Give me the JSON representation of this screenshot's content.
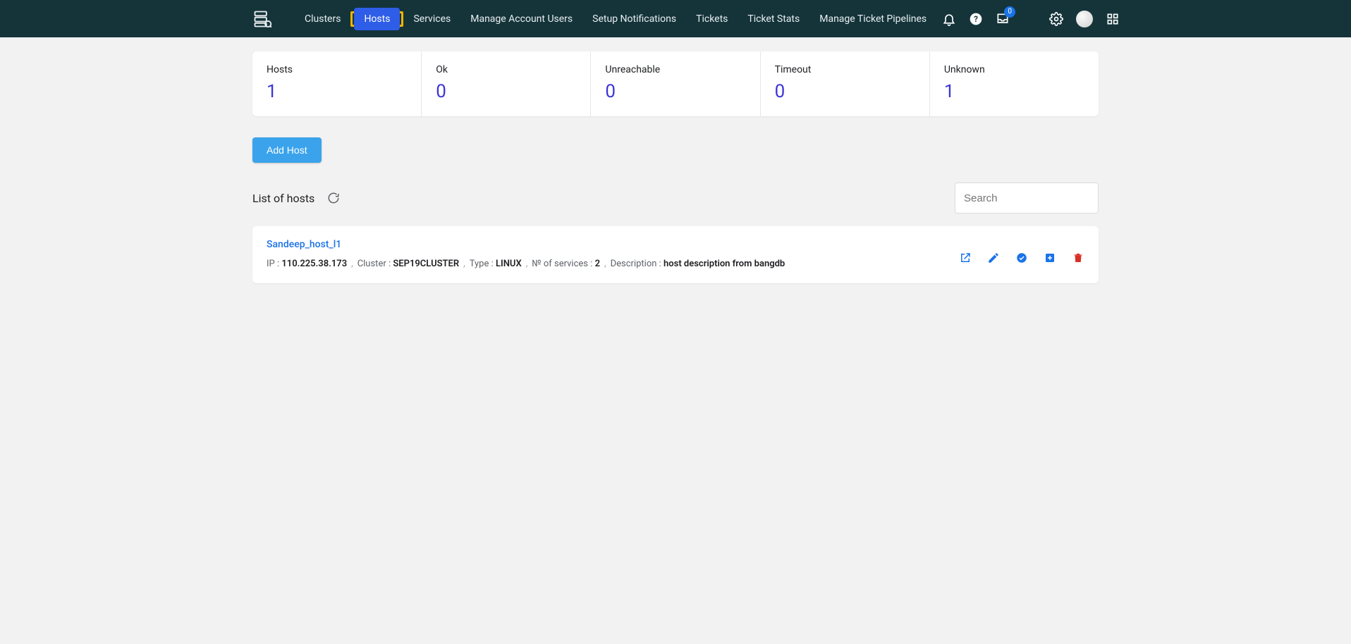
{
  "nav": {
    "items": [
      "Clusters",
      "Hosts",
      "Services",
      "Manage Account Users",
      "Setup Notifications",
      "Tickets",
      "Ticket Stats",
      "Manage Ticket Pipelines"
    ],
    "active_index": 1,
    "inbox_badge": "0"
  },
  "stats": [
    {
      "label": "Hosts",
      "value": "1"
    },
    {
      "label": "Ok",
      "value": "0"
    },
    {
      "label": "Unreachable",
      "value": "0"
    },
    {
      "label": "Timeout",
      "value": "0"
    },
    {
      "label": "Unknown",
      "value": "1"
    }
  ],
  "buttons": {
    "add_host": "Add Host"
  },
  "list": {
    "title": "List of hosts",
    "search_placeholder": "Search"
  },
  "host": {
    "name": "Sandeep_host_l1",
    "ip_label": "IP : ",
    "ip": "110.225.38.173",
    "cluster_label": "Cluster : ",
    "cluster": "SEP19CLUSTER",
    "type_label": "Type : ",
    "type": "LINUX",
    "services_label": "№ of services : ",
    "services": "2",
    "desc_label": "Description : ",
    "desc": "host description from bangdb"
  }
}
